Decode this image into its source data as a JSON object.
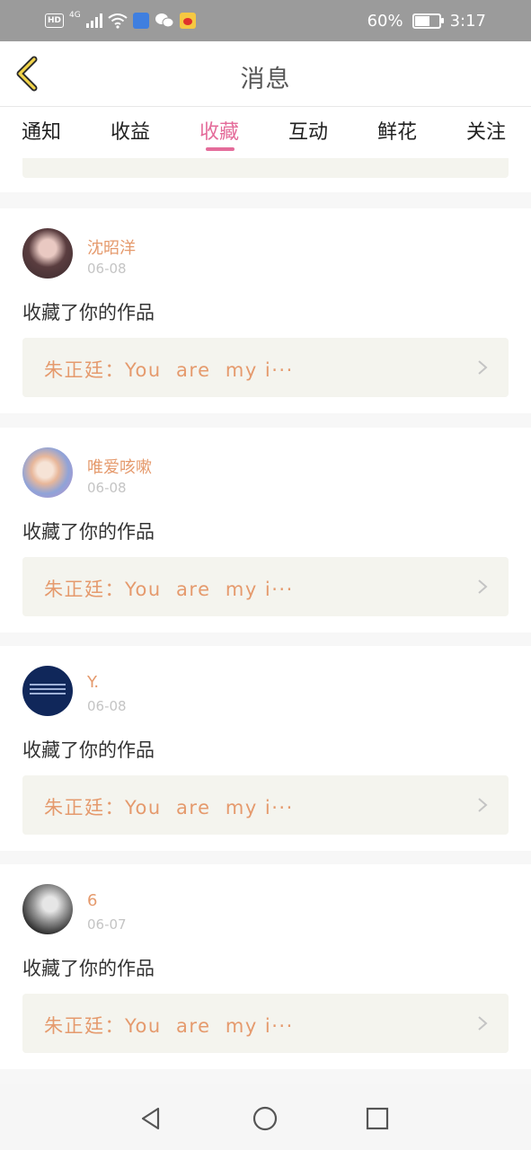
{
  "status_bar": {
    "hd": "HD",
    "network": "4G",
    "battery_text": "60%",
    "battery_level": 0.6,
    "time": "3:17"
  },
  "header": {
    "title": "消息",
    "back_icon": "chevron-left-icon"
  },
  "tabs": [
    {
      "label": "通知",
      "active": false
    },
    {
      "label": "收益",
      "active": false
    },
    {
      "label": "收藏",
      "active": true
    },
    {
      "label": "互动",
      "active": false
    },
    {
      "label": "鲜花",
      "active": false
    },
    {
      "label": "关注",
      "active": false
    }
  ],
  "colors": {
    "accent": "#e46c9a",
    "username": "#e59a6d",
    "quote_bg": "#f4f4ee"
  },
  "feed": [
    {
      "username": "沈昭洋",
      "date": "06-08",
      "action": "收藏了你的作品",
      "quote": "朱正廷：You  are  my i···"
    },
    {
      "username": "唯爱咳嗽",
      "date": "06-08",
      "action": "收藏了你的作品",
      "quote": "朱正廷：You  are  my i···"
    },
    {
      "username": "Y.",
      "date": "06-08",
      "action": "收藏了你的作品",
      "quote": "朱正廷：You  are  my i···"
    },
    {
      "username": "6",
      "date": "06-07",
      "action": "收藏了你的作品",
      "quote": "朱正廷：You  are  my i···"
    }
  ],
  "nav": {
    "back": "triangle-back-icon",
    "home": "circle-home-icon",
    "recent": "square-recents-icon"
  }
}
